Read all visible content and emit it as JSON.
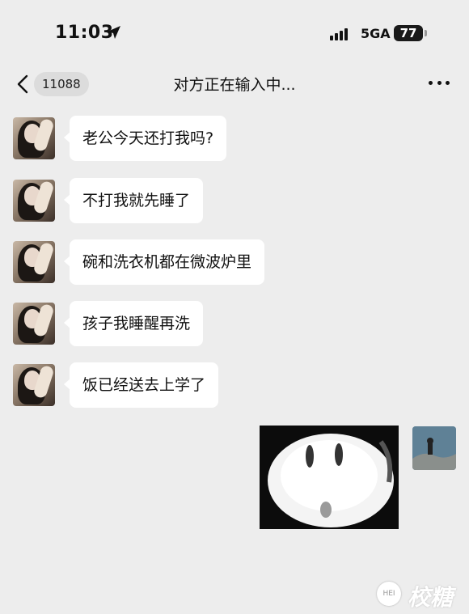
{
  "status_bar": {
    "time": "11:03",
    "network": "5GA",
    "battery": "77"
  },
  "nav": {
    "back_icon": "chevron-left-icon",
    "unread_count": "11088",
    "title": "对方正在输入中...",
    "more_icon": "more-icon"
  },
  "messages": [
    {
      "text": "老公今天还打我吗?"
    },
    {
      "text": "不打我就先睡了"
    },
    {
      "text": "碗和洗衣机都在微波炉里"
    },
    {
      "text": "孩子我睡醒再洗"
    },
    {
      "text": "饭已经送去上学了"
    }
  ],
  "watermark": {
    "text": "校糖",
    "logo_text": "HEI"
  },
  "colors": {
    "background": "#ededed",
    "bubble": "#ffffff",
    "badge": "#dcdcdc"
  }
}
